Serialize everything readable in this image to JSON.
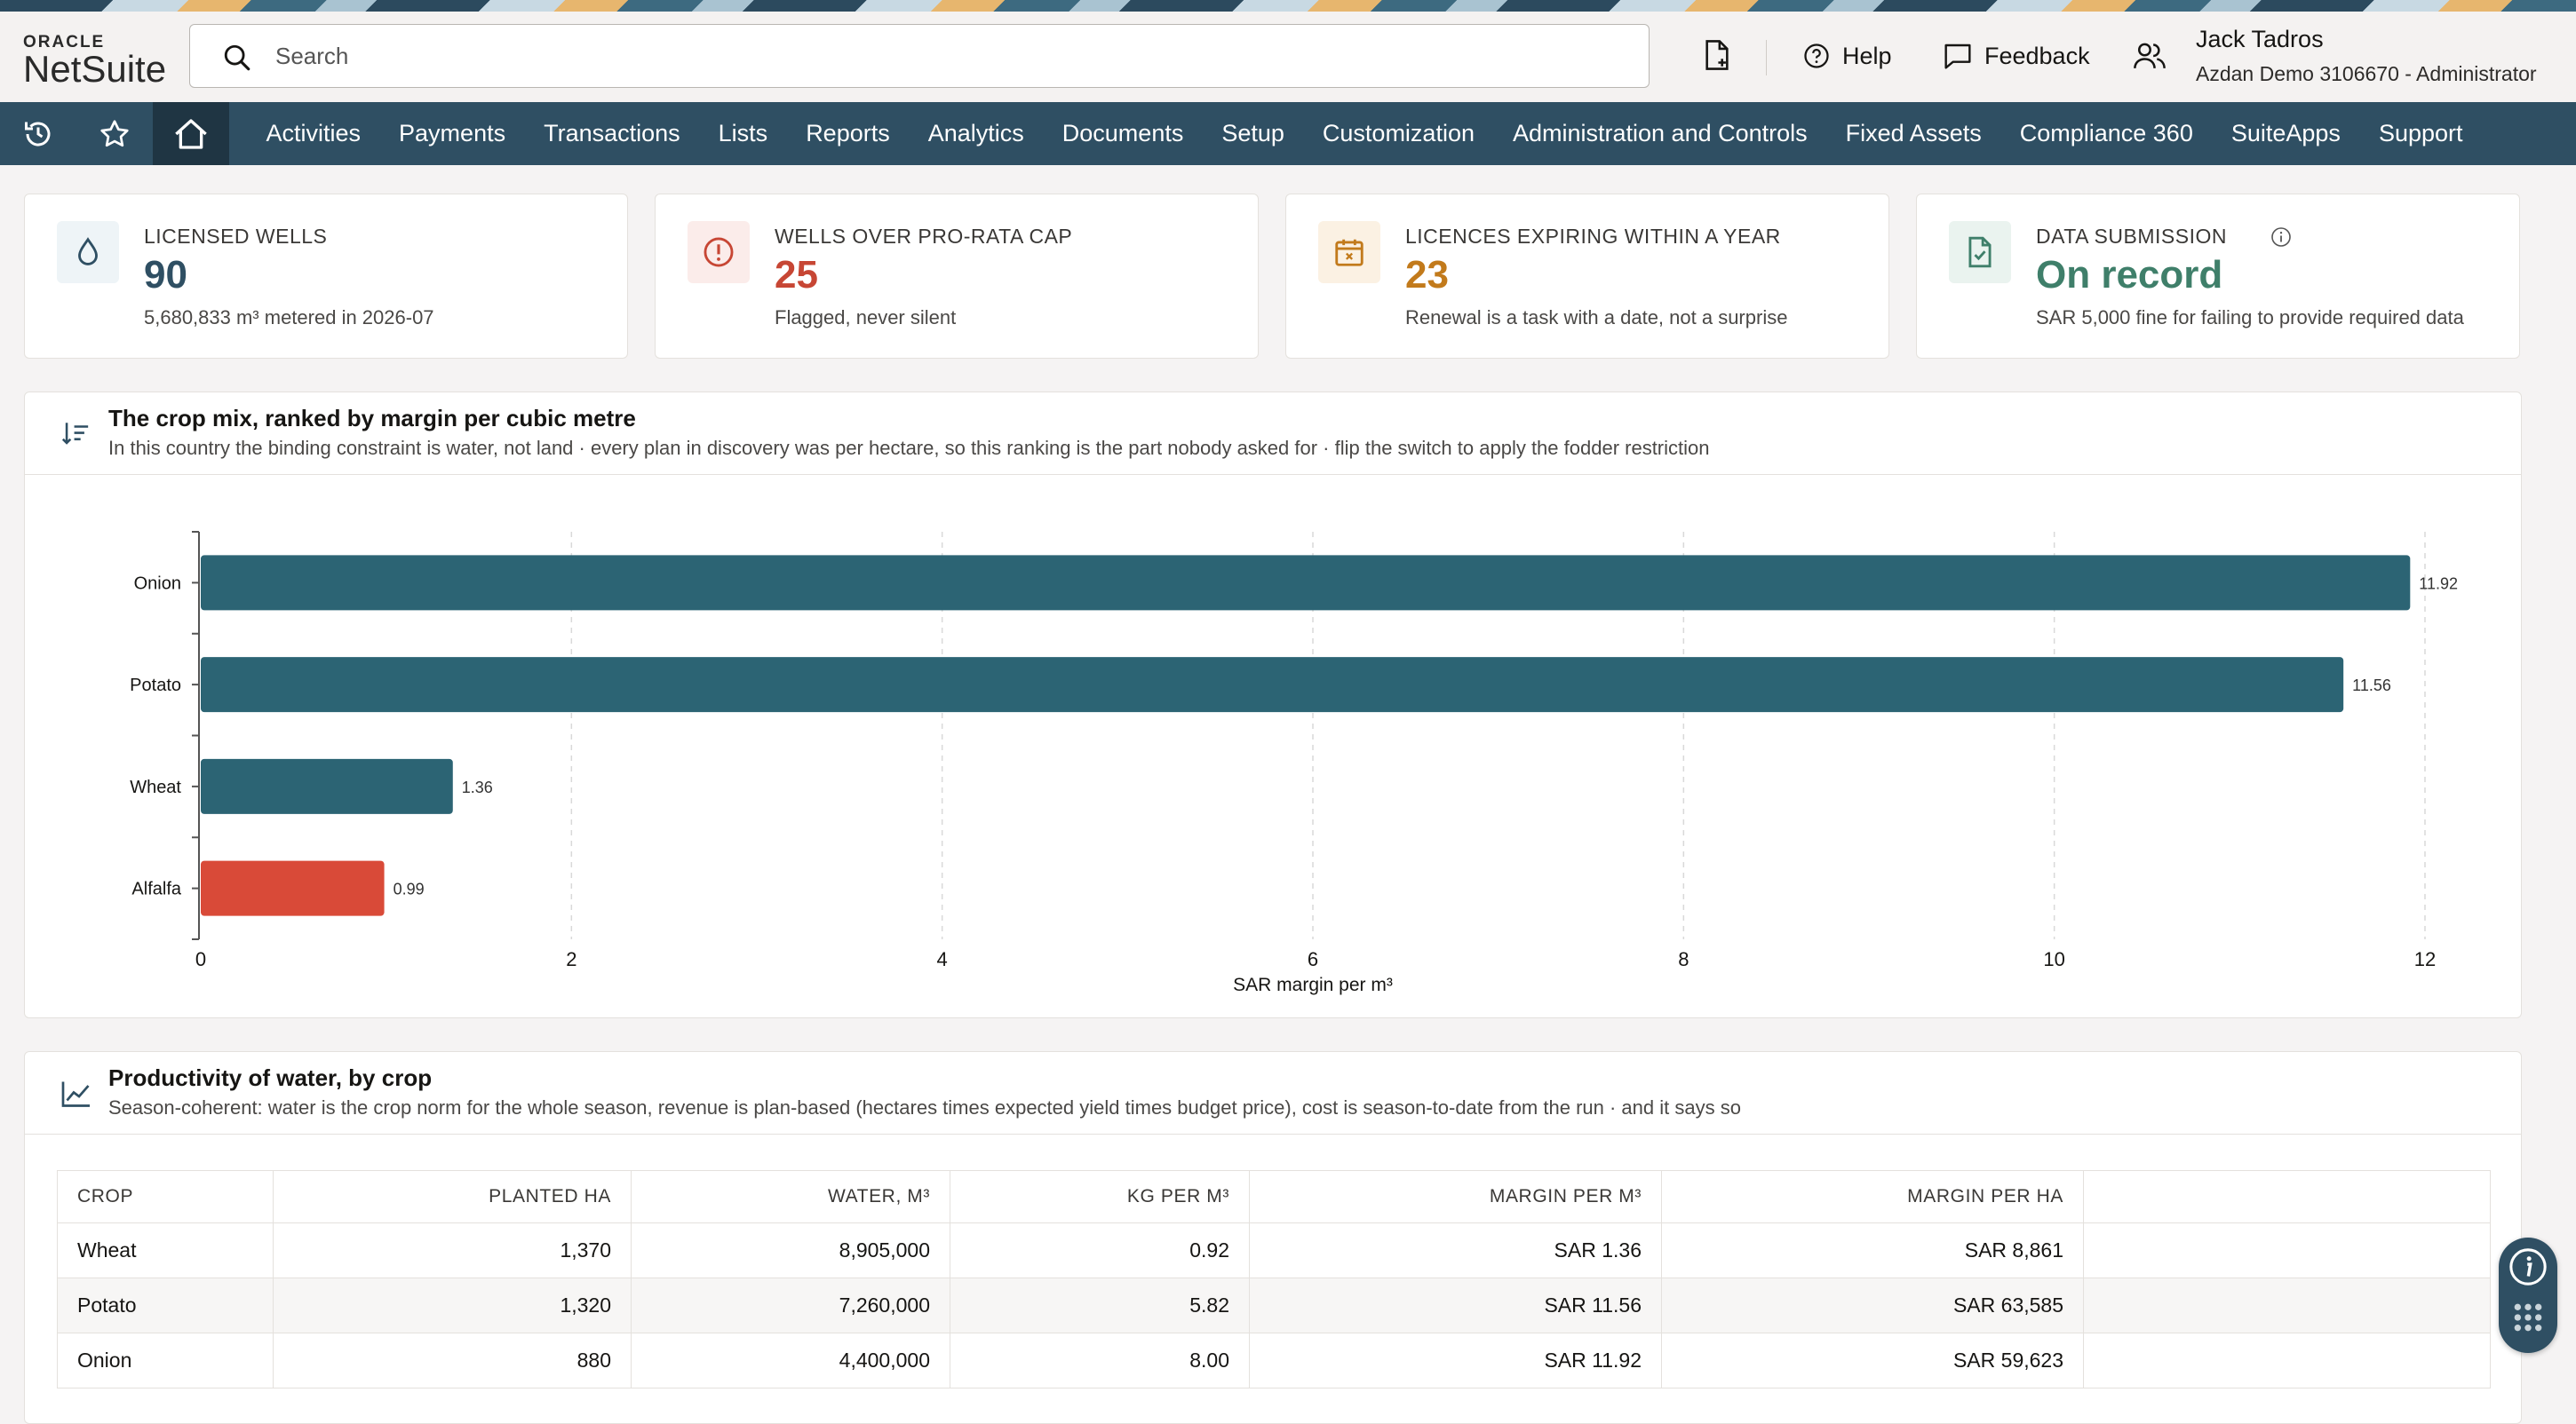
{
  "brand": {
    "oracle": "ORACLE",
    "netsuite": "NetSuite"
  },
  "search": {
    "placeholder": "Search"
  },
  "toolbar": {
    "help": "Help",
    "feedback": "Feedback"
  },
  "user": {
    "name": "Jack Tadros",
    "role": "Azdan Demo 3106670 - Administrator"
  },
  "nav": {
    "icons": [
      "recent-icon",
      "star-icon",
      "home-icon"
    ],
    "items": [
      "Activities",
      "Payments",
      "Transactions",
      "Lists",
      "Reports",
      "Analytics",
      "Documents",
      "Setup",
      "Customization",
      "Administration and Controls",
      "Fixed Assets",
      "Compliance 360",
      "SuiteApps",
      "Support"
    ]
  },
  "kpis": [
    {
      "label": "LICENSED WELLS",
      "value": "90",
      "sub": "5,680,833 m³ metered in 2026-07",
      "icon": "water-drop-icon",
      "color": "#2f4f63"
    },
    {
      "label": "WELLS OVER PRO-RATA CAP",
      "value": "25",
      "sub": "Flagged, never silent",
      "icon": "alert-icon",
      "color": "#c74634"
    },
    {
      "label": "LICENCES EXPIRING WITHIN A YEAR",
      "value": "23",
      "sub": "Renewal is a task with a date, not a surprise",
      "icon": "calendar-icon",
      "color": "#c27a1b"
    },
    {
      "label": "DATA SUBMISSION",
      "value": "On record",
      "sub": "SAR 5,000 fine for failing to provide required data",
      "icon": "document-check-icon",
      "color": "#3f7f6a"
    }
  ],
  "chart_panel": {
    "title": "The crop mix, ranked by margin per cubic metre",
    "subtitle": "In this country the binding constraint is water, not land · every plan in discovery was per hectare, so this ranking is the part nobody asked for · flip the switch to apply the fodder restriction"
  },
  "chart_data": {
    "type": "bar",
    "orientation": "horizontal",
    "categories": [
      "Onion",
      "Potato",
      "Wheat",
      "Alfalfa"
    ],
    "values": [
      11.92,
      11.56,
      1.36,
      0.99
    ],
    "colors": [
      "#2c6474",
      "#2c6474",
      "#2c6474",
      "#d94a38"
    ],
    "xlabel": "SAR margin per m³",
    "xlim": [
      0,
      12
    ],
    "xticks": [
      0,
      2,
      4,
      6,
      8,
      10,
      12
    ],
    "grid": true
  },
  "table_panel": {
    "title": "Productivity of water, by crop",
    "subtitle": "Season-coherent: water is the crop norm for the whole season, revenue is plan-based (hectares times expected yield times budget price), cost is season-to-date from the run · and it says so",
    "columns": [
      "CROP",
      "PLANTED HA",
      "WATER, M³",
      "KG PER M³",
      "MARGIN PER M³",
      "MARGIN PER HA"
    ],
    "rows": [
      [
        "Wheat",
        "1,370",
        "8,905,000",
        "0.92",
        "SAR 1.36",
        "SAR 8,861"
      ],
      [
        "Potato",
        "1,320",
        "7,260,000",
        "5.82",
        "SAR 11.56",
        "SAR 63,585"
      ],
      [
        "Onion",
        "880",
        "4,400,000",
        "8.00",
        "SAR 11.92",
        "SAR 59,623"
      ]
    ]
  }
}
